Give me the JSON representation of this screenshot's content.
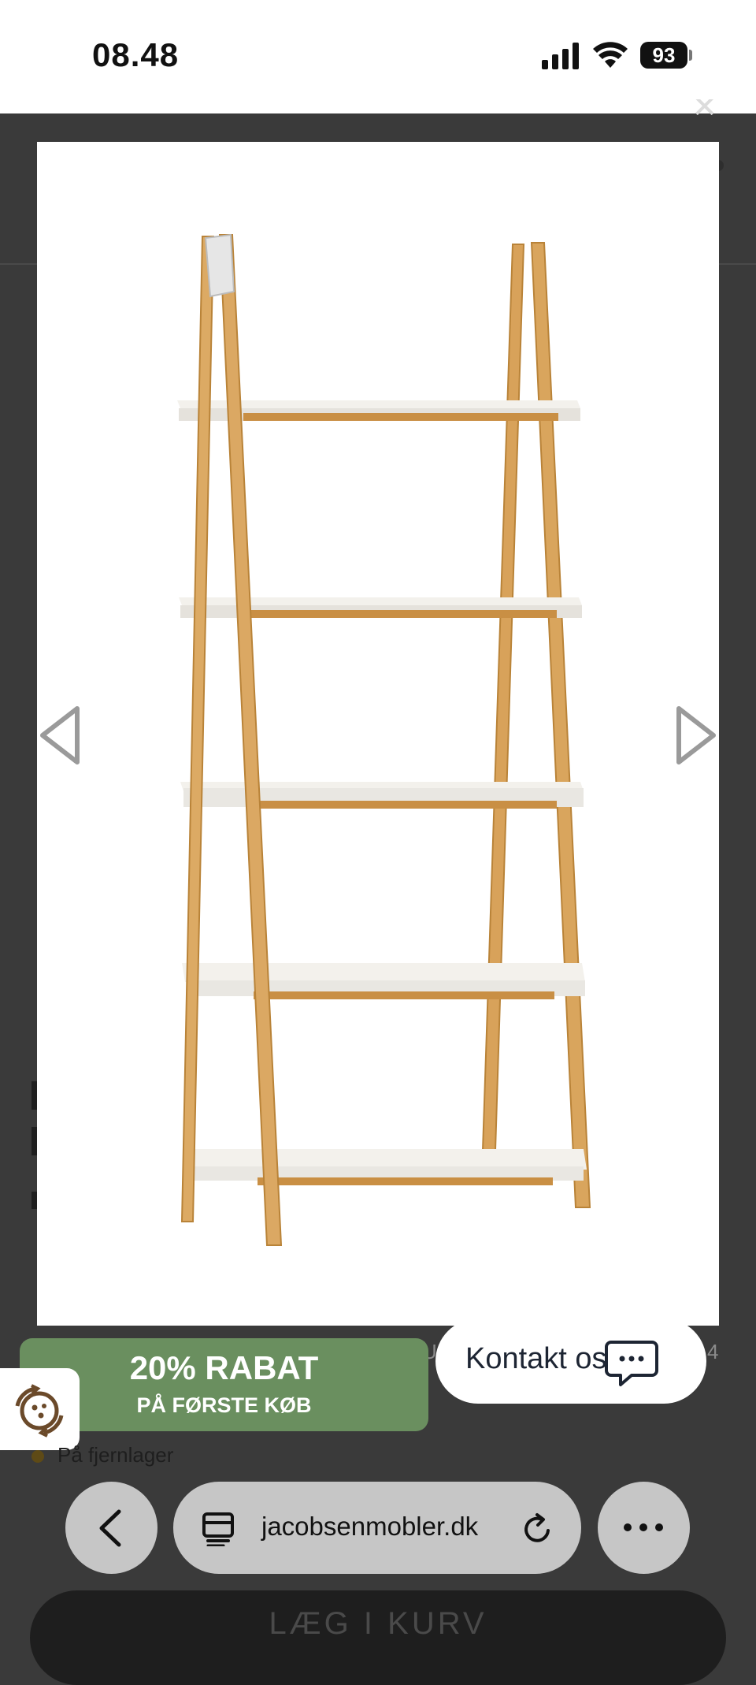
{
  "status_bar": {
    "time": "08.48",
    "battery": "93"
  },
  "product_image": {
    "alt": "Ladder bookshelf with oak frame and white shelves"
  },
  "promo": {
    "title": "20% RABAT",
    "subtitle": "PÅ FØRSTE KØB"
  },
  "contact": {
    "label": "Kontakt os"
  },
  "stock": {
    "text": "På fjernlager"
  },
  "browser": {
    "url": "jacobsenmobler.dk"
  },
  "cart": {
    "label": "LÆG I KURV"
  },
  "colors": {
    "promo_bg": "#6a8f5f",
    "overlay_bg": "#3a3a3a",
    "contact_text": "#1d2533"
  }
}
